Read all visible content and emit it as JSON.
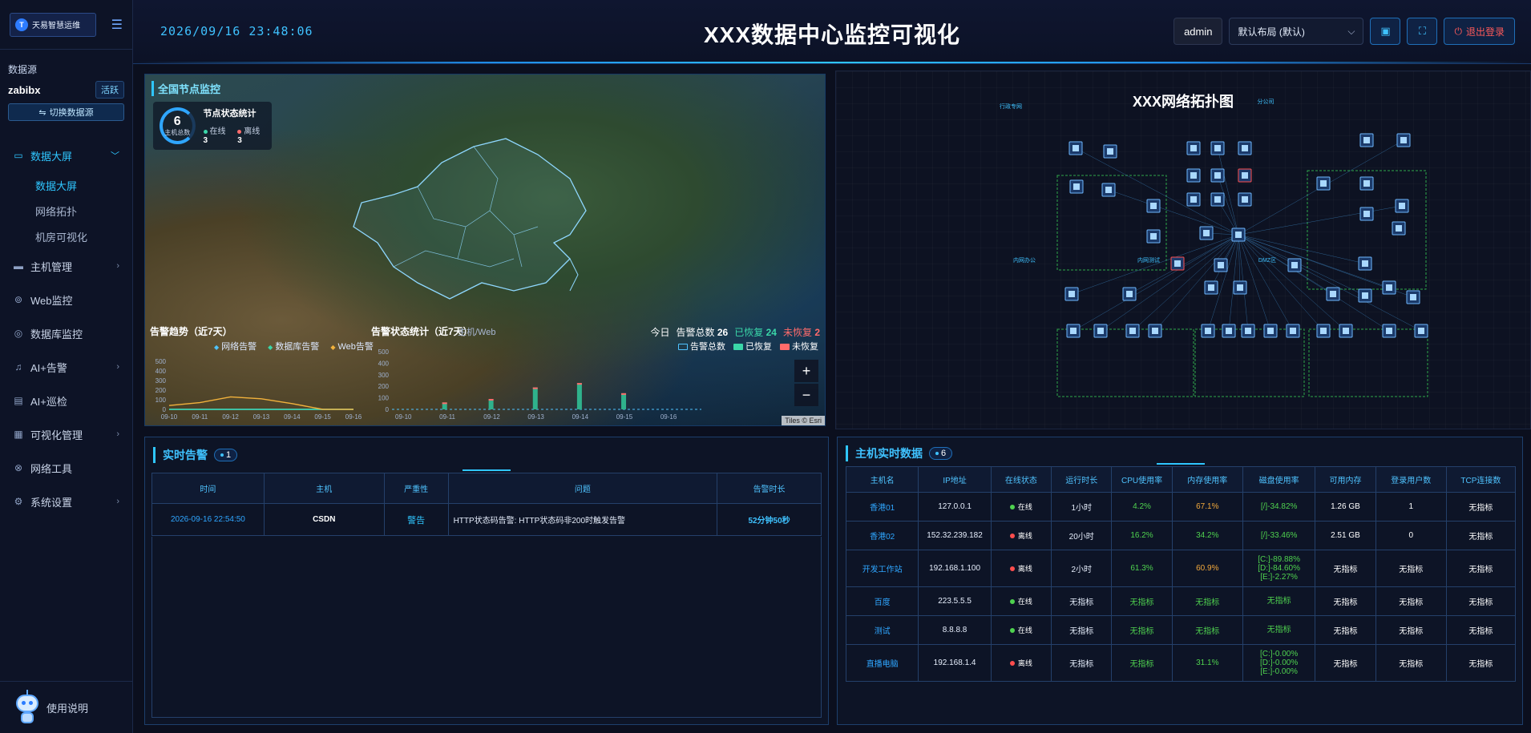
{
  "app": {
    "logo_text": "天易智慧运维",
    "logo_mark": "T"
  },
  "sidebar": {
    "datasource_label": "数据源",
    "datasource_name": "zabibx",
    "datasource_badge": "活跃",
    "switch_label": "切换数据源",
    "menu": [
      {
        "label": "数据大屏",
        "icon": "monitor-icon"
      },
      {
        "label": "主机管理",
        "icon": "server-icon"
      },
      {
        "label": "Web监控",
        "icon": "web-icon"
      },
      {
        "label": "数据库监控",
        "icon": "database-icon"
      },
      {
        "label": "AI+告警",
        "icon": "bell-icon"
      },
      {
        "label": "AI+巡检",
        "icon": "document-icon"
      },
      {
        "label": "可视化管理",
        "icon": "grid-icon"
      },
      {
        "label": "网络工具",
        "icon": "link-icon"
      },
      {
        "label": "系统设置",
        "icon": "gear-icon"
      }
    ],
    "submenu": [
      "数据大屏",
      "网络拓扑",
      "机房可视化"
    ],
    "footer_label": "使用说明"
  },
  "header": {
    "clock": "2026/09/16 23:48:06",
    "title": "XXX数据中心监控可视化",
    "user": "admin",
    "layout_select": "默认布局 (默认)",
    "logout": "退出登录"
  },
  "map": {
    "title": "全国节点监控",
    "node_stat_title": "节点状态统计",
    "total": "6",
    "total_label": "主机总数",
    "online_label": "在线",
    "online": "3",
    "offline_label": "离线",
    "offline": "3",
    "attribution": "Tiles © Esri",
    "trend_title": "告警趋势（近7天）",
    "trend_legend": [
      "网络告警",
      "数据库告警",
      "Web告警"
    ],
    "alarm_title": "告警状态统计（近7天）",
    "alarm_sub": "主机/Web",
    "today_label": "今日",
    "today_total_label": "告警总数",
    "today_total": "26",
    "today_recovered_label": "已恢复",
    "today_recovered": "24",
    "today_unrecovered_label": "未恢复",
    "today_unrecovered": "2",
    "alarm_legend": [
      "告警总数",
      "已恢复",
      "未恢复"
    ],
    "zoom_in": "+",
    "zoom_out": "−"
  },
  "chart_data": [
    {
      "type": "line",
      "title": "告警趋势（近7天）",
      "x": [
        "09-10",
        "09-11",
        "09-12",
        "09-13",
        "09-14",
        "09-15",
        "09-16"
      ],
      "ylim": [
        0,
        500
      ],
      "yticks": [
        0,
        100,
        200,
        300,
        400,
        500
      ],
      "series": [
        {
          "name": "网络告警",
          "values": [
            0,
            0,
            0,
            0,
            0,
            0,
            0
          ]
        },
        {
          "name": "数据库告警",
          "values": [
            0,
            0,
            0,
            0,
            0,
            0,
            0
          ]
        },
        {
          "name": "Web告警",
          "values": [
            40,
            70,
            130,
            110,
            60,
            0,
            0
          ]
        }
      ]
    },
    {
      "type": "bar",
      "title": "告警状态统计（近7天）",
      "categories": [
        "09-10",
        "09-11",
        "09-12",
        "09-13",
        "09-14",
        "09-15",
        "09-16"
      ],
      "ylim": [
        0,
        500
      ],
      "yticks": [
        0,
        50,
        100,
        150,
        200,
        250,
        300,
        350,
        400,
        450,
        500
      ],
      "series": [
        {
          "name": "告警总数",
          "values": [
            0,
            0,
            0,
            0,
            0,
            0,
            0
          ]
        },
        {
          "name": "已恢复",
          "values": [
            0,
            0,
            0,
            0,
            0,
            0,
            0
          ]
        },
        {
          "name": "未恢复",
          "values": [
            0,
            0,
            0,
            0,
            0,
            0,
            0
          ]
        }
      ],
      "bar_values": [
        [
          10,
          0,
          0
        ],
        [
          15,
          90,
          0
        ],
        [
          20,
          0,
          0
        ],
        [
          25,
          0,
          0
        ],
        [
          20,
          0,
          0
        ],
        [
          5,
          0,
          0
        ],
        [
          10,
          0,
          0
        ]
      ],
      "tall_bars": [
        {
          "x": 1,
          "value": 60
        },
        {
          "x": 2.05,
          "value": 90
        },
        {
          "x": 3.05,
          "value": 190
        },
        {
          "x": 4.05,
          "value": 228
        },
        {
          "x": 5.05,
          "value": 140
        }
      ]
    }
  ],
  "topology": {
    "title": "XXX网络拓扑图",
    "groups": [
      "行政专网",
      "分公司",
      "内网办公",
      "内网测试",
      "DMZ区"
    ]
  },
  "alerts": {
    "title": "实时告警",
    "count": "1",
    "columns": [
      "时间",
      "主机",
      "严重性",
      "问题",
      "告警时长"
    ],
    "rows": [
      {
        "time": "2026-09-16 22:54:50",
        "host": "CSDN",
        "severity": "警告",
        "problem": "HTTP状态码告警: HTTP状态码非200时触发告警",
        "duration": "52分钟50秒"
      }
    ]
  },
  "hosts": {
    "title": "主机实时数据",
    "count": "6",
    "columns": [
      "主机名",
      "IP地址",
      "在线状态",
      "运行时长",
      "CPU使用率",
      "内存使用率",
      "磁盘使用率",
      "可用内存",
      "登录用户数",
      "TCP连接数"
    ],
    "rows": [
      {
        "name": "香港01",
        "ip": "127.0.0.1",
        "status": "在线",
        "uptime": "1小时",
        "cpu": "4.2%",
        "mem": "67.1%",
        "disk": [
          "[/]-34.82%"
        ],
        "free": "1.26 GB",
        "users": "1",
        "tcp": "无指标"
      },
      {
        "name": "香港02",
        "ip": "152.32.239.182",
        "status": "离线",
        "uptime": "20小时",
        "cpu": "16.2%",
        "mem": "34.2%",
        "disk": [
          "[/]-33.46%"
        ],
        "free": "2.51 GB",
        "users": "0",
        "tcp": "无指标"
      },
      {
        "name": "开发工作站",
        "ip": "192.168.1.100",
        "status": "离线",
        "uptime": "2小时",
        "cpu": "61.3%",
        "mem": "60.9%",
        "disk": [
          "[C:]-89.88%",
          "[D:]-84.60%",
          "[E:]-2.27%"
        ],
        "free": "无指标",
        "users": "无指标",
        "tcp": "无指标"
      },
      {
        "name": "百度",
        "ip": "223.5.5.5",
        "status": "在线",
        "uptime": "无指标",
        "cpu": "无指标",
        "mem": "无指标",
        "disk": [
          "无指标"
        ],
        "free": "无指标",
        "users": "无指标",
        "tcp": "无指标"
      },
      {
        "name": "测试",
        "ip": "8.8.8.8",
        "status": "在线",
        "uptime": "无指标",
        "cpu": "无指标",
        "mem": "无指标",
        "disk": [
          "无指标"
        ],
        "free": "无指标",
        "users": "无指标",
        "tcp": "无指标"
      },
      {
        "name": "直播电脑",
        "ip": "192.168.1.4",
        "status": "离线",
        "uptime": "无指标",
        "cpu": "无指标",
        "mem": "31.1%",
        "disk": [
          "[C:]-0.00%",
          "[D:]-0.00%",
          "[E:]-0.00%"
        ],
        "free": "无指标",
        "users": "无指标",
        "tcp": "无指标"
      }
    ]
  },
  "colors": {
    "accent": "#2fc6ff",
    "online": "#4fd24f",
    "offline": "#ff4d4d",
    "recovered": "#3ad6a8",
    "unrecovered": "#ff6b6b"
  }
}
